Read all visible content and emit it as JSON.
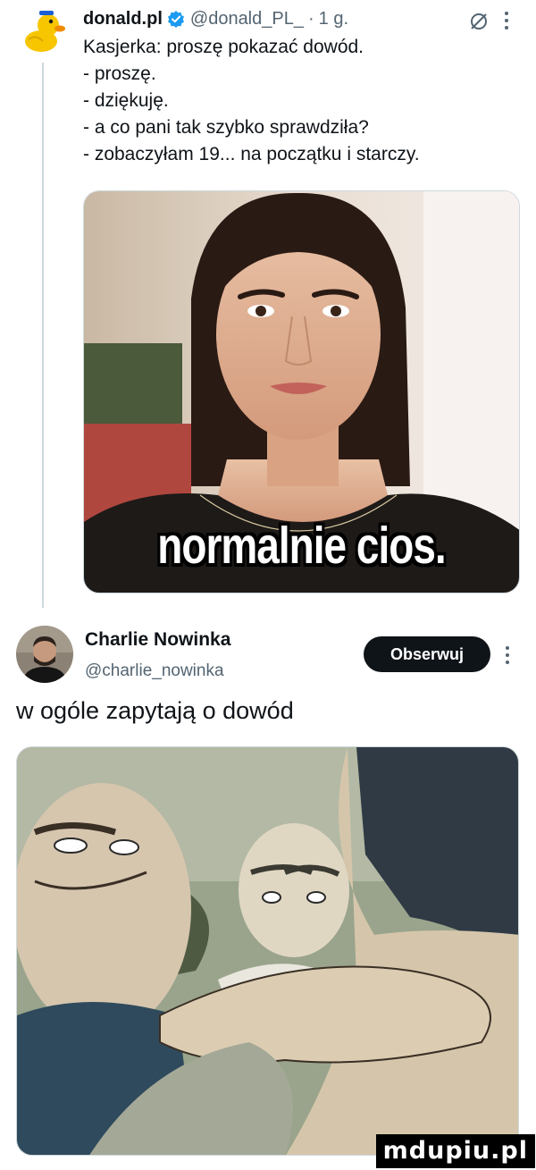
{
  "tweet1": {
    "author_name": "donald.pl",
    "handle": "@donald_PL_",
    "separator": "·",
    "time": "1 g.",
    "lines": [
      "Kasjerka: proszę pokazać dowód.",
      "- proszę.",
      "- dziękuję.",
      "- a co pani tak szybko sprawdziła?",
      "- zobaczyłam 19... na początku i starczy."
    ],
    "media": {
      "caption": "normalnie cios."
    },
    "icons": {
      "avatar": "duck-avatar-icon",
      "verified": "verified-badge-icon",
      "grok": "grok-icon",
      "more": "more-options-icon"
    },
    "colors": {
      "verified": "#1d9bf0"
    }
  },
  "tweet2": {
    "author_name": "Charlie Nowinka",
    "handle": "@charlie_nowinka",
    "follow_label": "Obserwuj",
    "text": "w ogóle zapytają o dowód",
    "icons": {
      "more": "more-options-icon"
    }
  },
  "watermark": {
    "text": "mdupiu.pl"
  }
}
